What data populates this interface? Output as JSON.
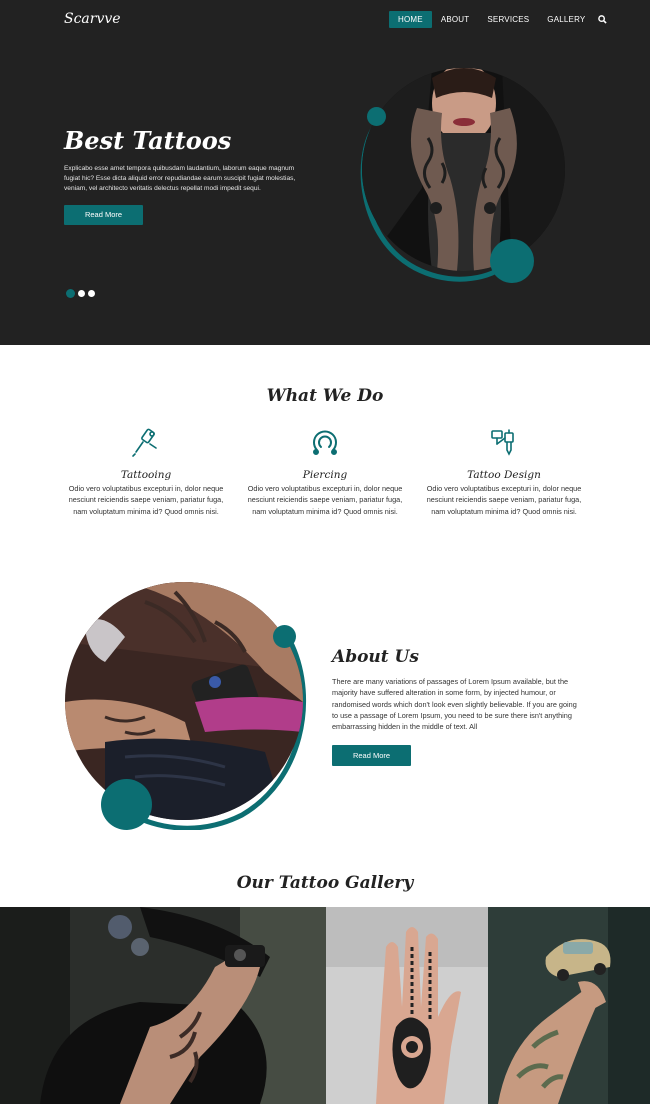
{
  "header": {
    "logo": "Scarvve",
    "nav": [
      {
        "label": "HOME",
        "active": true
      },
      {
        "label": "ABOUT",
        "active": false
      },
      {
        "label": "SERVICES",
        "active": false
      },
      {
        "label": "GALLERY",
        "active": false
      }
    ],
    "search_icon": "search-icon"
  },
  "hero": {
    "title": "Best Tattoos",
    "text": "Explicabo esse amet tempora quibusdam laudantium, laborum eaque magnum fugiat hic? Esse dicta aliquid error repudiandae earum suscipit fugiat molestias, veniam, vel architecto veritatis delectus repellat modi impedit sequi.",
    "button": "Read More",
    "slides": 3,
    "active_slide": 1
  },
  "services": {
    "title": "What We Do",
    "items": [
      {
        "name": "Tattooing",
        "icon": "tattoo-machine-icon",
        "desc": "Odio vero voluptatibus excepturi in, dolor neque nesciunt reiciendis saepe veniam, pariatur fuga, nam voluptatum minima id? Quod omnis nisi."
      },
      {
        "name": "Piercing",
        "icon": "piercing-ring-icon",
        "desc": "Odio vero voluptatibus excepturi in, dolor neque nesciunt reiciendis saepe veniam, pariatur fuga, nam voluptatum minima id? Quod omnis nisi."
      },
      {
        "name": "Tattoo Design",
        "icon": "tattoo-gun-icon",
        "desc": "Odio vero voluptatibus excepturi in, dolor neque nesciunt reiciendis saepe veniam, pariatur fuga, nam voluptatum minima id? Quod omnis nisi."
      }
    ]
  },
  "about": {
    "title": "About Us",
    "text": "There are many variations of passages of Lorem Ipsum available, but the majority have suffered alteration in some form, by injected humour, or randomised words which don't look even slightly believable. If you are going to use a passage of Lorem Ipsum, you need to be sure there isn't anything embarrassing hidden in the middle of text. All",
    "button": "Read More"
  },
  "gallery": {
    "title": "Our Tattoo Gallery"
  },
  "colors": {
    "accent": "#0c6e72",
    "hero_bg": "#222222"
  }
}
